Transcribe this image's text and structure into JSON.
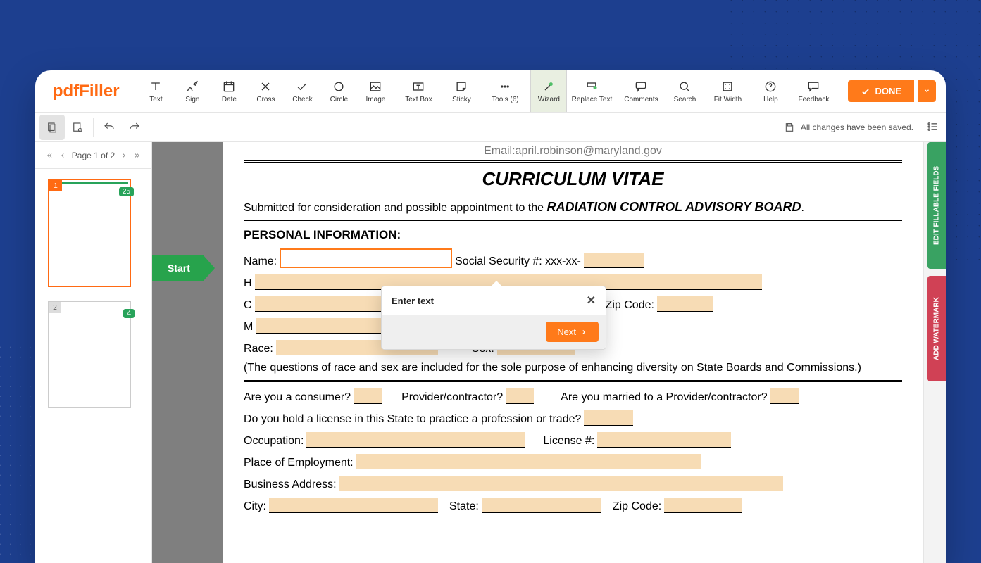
{
  "brand": "pdfFiller",
  "toolbar": {
    "text": "Text",
    "sign": "Sign",
    "date": "Date",
    "cross": "Cross",
    "check": "Check",
    "circle": "Circle",
    "image": "Image",
    "textbox": "Text Box",
    "sticky": "Sticky",
    "tools": "Tools (6)",
    "wizard": "Wizard",
    "replace": "Replace Text",
    "comments": "Comments",
    "search": "Search",
    "fit": "Fit Width",
    "help": "Help",
    "feedback": "Feedback",
    "done": "DONE"
  },
  "status": {
    "saved": "All changes have been saved."
  },
  "pager": {
    "label": "Page  1 of 2"
  },
  "thumbs": {
    "p1badge": "25",
    "p2badge": "4",
    "p1": "1",
    "p2": "2"
  },
  "start_flag": "Start",
  "rails": {
    "fill": "EDIT FILLABLE FIELDS",
    "watermark": "ADD WATERMARK"
  },
  "popover": {
    "title": "Enter text",
    "next": "Next"
  },
  "doc": {
    "email": "Email:april.robinson@maryland.gov",
    "title": "CURRICULUM VITAE",
    "submitted_pre": "Submitted for consideration and possible appointment to the ",
    "submitted_bold": "RADIATION CONTROL ADVISORY BOARD",
    "section_personal": "PERSONAL INFORMATION:",
    "name": "Name:",
    "ssn": "Social Security #: xxx-xx-",
    "h": "H",
    "c": "C",
    "zip": "Zip Code:",
    "m": "M",
    "race": "Race:",
    "sex": "Sex:",
    "diversity": "(The questions of race and sex are included for the sole purpose of enhancing diversity on State Boards and Commissions.)",
    "consumer": "Are you a consumer?",
    "provider": "Provider/contractor?",
    "married": "Are you married to a Provider/contractor?",
    "license_q": "Do you hold a license in this State to practice a profession or trade?",
    "occupation": "Occupation:",
    "license_no": "License #:",
    "employment": "Place of Employment:",
    "biz": "Business Address:",
    "city": "City:",
    "state": "State:",
    "zip2": "Zip Code:"
  }
}
